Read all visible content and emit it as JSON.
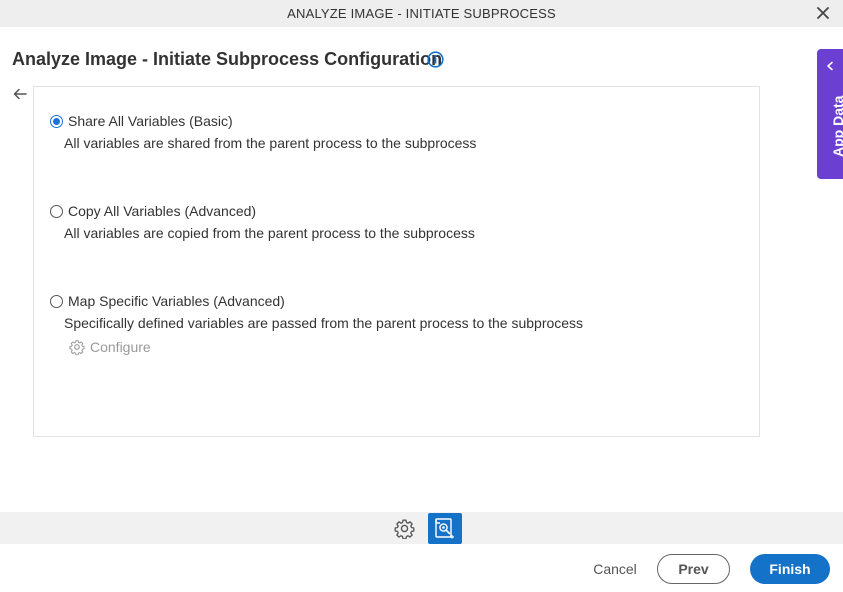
{
  "window": {
    "title": "ANALYZE IMAGE - INITIATE SUBPROCESS",
    "close_icon": "close-icon"
  },
  "header": {
    "title": "Analyze Image - Initiate Subprocess Configuration",
    "info_icon": "info-icon"
  },
  "options": [
    {
      "label": "Share All Variables (Basic)",
      "description": "All variables are shared from the parent process to the subprocess",
      "selected": true
    },
    {
      "label": "Copy All Variables (Advanced)",
      "description": "All variables are copied from the parent process to the subprocess",
      "selected": false
    },
    {
      "label": "Map Specific Variables (Advanced)",
      "description": "Specifically defined variables are passed from the parent process to the subprocess",
      "selected": false
    }
  ],
  "configure_link": "Configure",
  "side_panel": {
    "label": "App Data",
    "color": "#6b3fd1"
  },
  "footer": {
    "cancel": "Cancel",
    "prev": "Prev",
    "finish": "Finish"
  },
  "colors": {
    "accent": "#1572c9",
    "side_tab": "#6b3fd1"
  }
}
